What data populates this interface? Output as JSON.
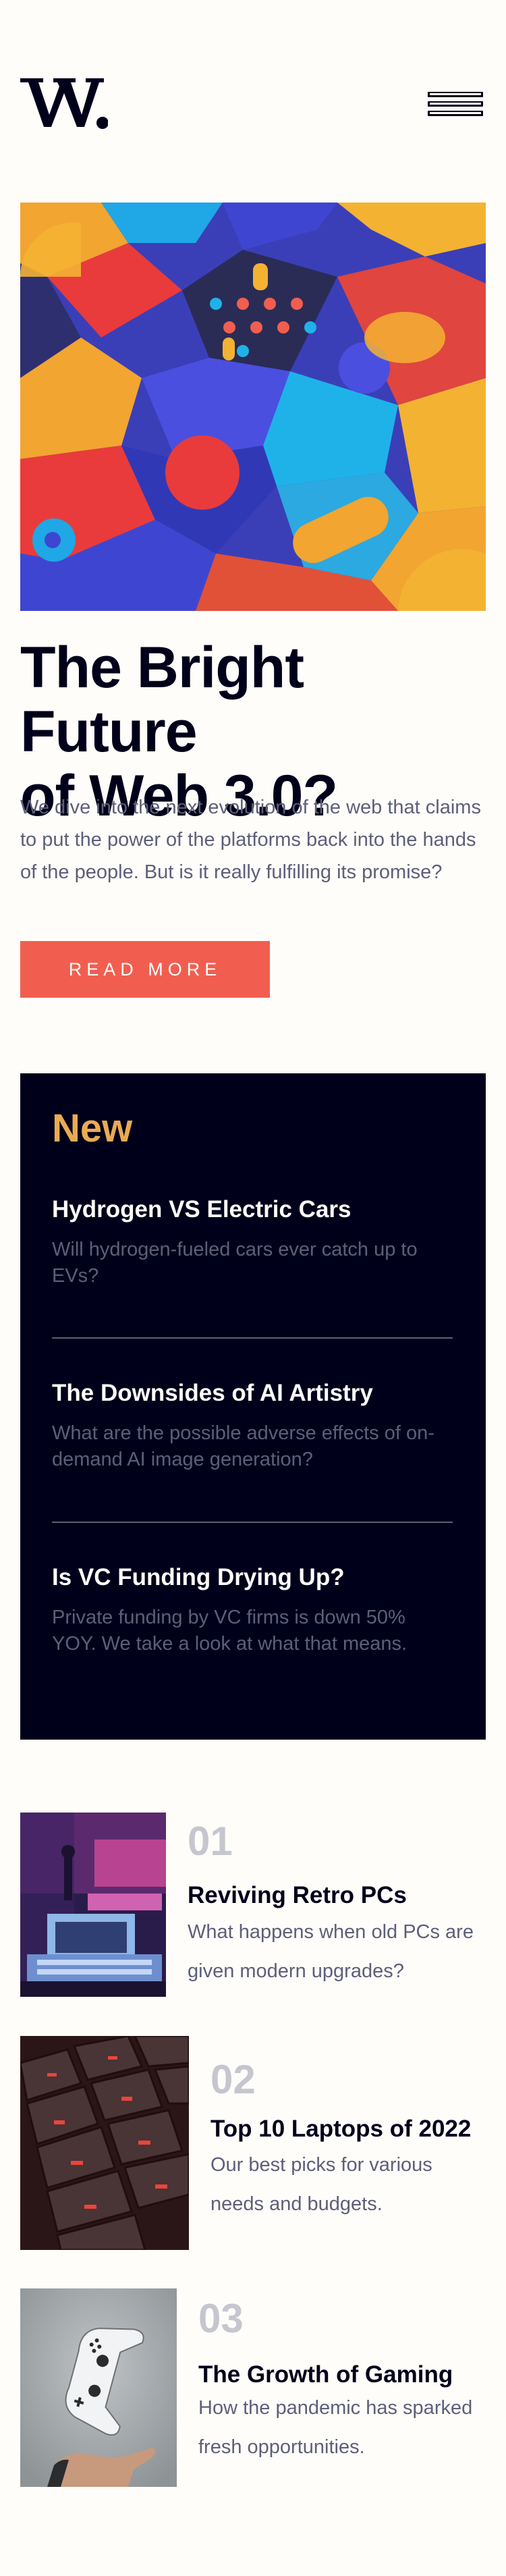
{
  "header": {
    "logo_text": "W.",
    "menu_icon": "hamburger-menu-icon"
  },
  "hero": {
    "title_line1": "The Bright Future",
    "title_line2": "of Web 3.0?",
    "description": "We dive into the next evolution of the web that claims to put the power of the platforms back into the hands of the people. But is it really fulfilling its promise?",
    "button_label": "READ MORE"
  },
  "new_section": {
    "heading": "New",
    "items": [
      {
        "title": "Hydrogen VS Electric Cars",
        "text": "Will hydrogen-fueled cars ever catch up to EVs?"
      },
      {
        "title": "The Downsides of AI Artistry",
        "text": "What are the possible adverse effects of on-demand AI image generation?"
      },
      {
        "title": "Is VC Funding Drying Up?",
        "text": "Private funding by VC firms is down 50% YOY. We take a look at what that means."
      }
    ]
  },
  "articles": [
    {
      "number": "01",
      "title": "Reviving Retro PCs",
      "text": "What happens when old PCs are given modern upgrades?"
    },
    {
      "number": "02",
      "title": "Top 10 Laptops of 2022",
      "text": "Our best picks for various needs and budgets."
    },
    {
      "number": "03",
      "title": "The Growth of Gaming",
      "text": "How the pandemic has sparked fresh opportunities."
    }
  ],
  "colors": {
    "off_white": "#fffdfa",
    "very_dark_blue": "#00001a",
    "soft_orange": "#e9ab53",
    "soft_red": "#f15e50",
    "grayish_blue": "#5d5f79",
    "muted_gray": "#c5c6ce"
  }
}
